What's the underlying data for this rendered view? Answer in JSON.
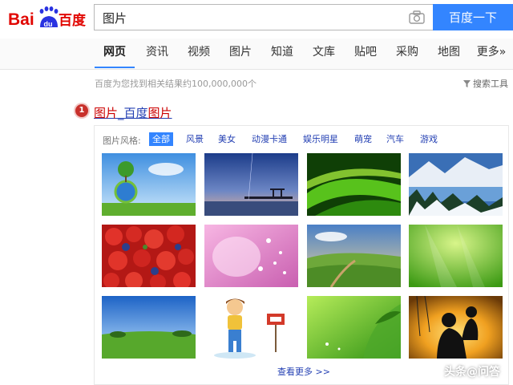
{
  "app": {
    "logo_text_left": "Bai",
    "logo_text_du": "du",
    "logo_text_right": "百度"
  },
  "search": {
    "value": "图片",
    "button_label": "百度一下"
  },
  "tabs": [
    {
      "label": "网页",
      "active": true
    },
    {
      "label": "资讯",
      "active": false
    },
    {
      "label": "视频",
      "active": false
    },
    {
      "label": "图片",
      "active": false
    },
    {
      "label": "知道",
      "active": false
    },
    {
      "label": "文库",
      "active": false
    },
    {
      "label": "贴吧",
      "active": false
    },
    {
      "label": "采购",
      "active": false
    },
    {
      "label": "地图",
      "active": false
    },
    {
      "label": "更多»",
      "active": false
    }
  ],
  "results": {
    "count_text": "百度为您找到相关结果约100,000,000个",
    "search_tools": "搜索工具",
    "first": {
      "rank": "1",
      "title_part1": "图片",
      "title_sep": "_百度",
      "title_part2": "图片"
    }
  },
  "image_panel": {
    "filter_label": "图片风格:",
    "filters": [
      {
        "label": "全部",
        "active": true
      },
      {
        "label": "风景",
        "active": false
      },
      {
        "label": "美女",
        "active": false
      },
      {
        "label": "动漫卡通",
        "active": false
      },
      {
        "label": "娱乐明星",
        "active": false
      },
      {
        "label": "萌宠",
        "active": false
      },
      {
        "label": "汽车",
        "active": false
      },
      {
        "label": "游戏",
        "active": false
      }
    ],
    "more_link": "查看更多 >>"
  },
  "watermark": "头条@问答",
  "colors": {
    "accent": "#3385ff",
    "logo_red": "#e10601",
    "logo_blue": "#2932e1",
    "link": "#2440b3",
    "highlight": "#c00000"
  }
}
